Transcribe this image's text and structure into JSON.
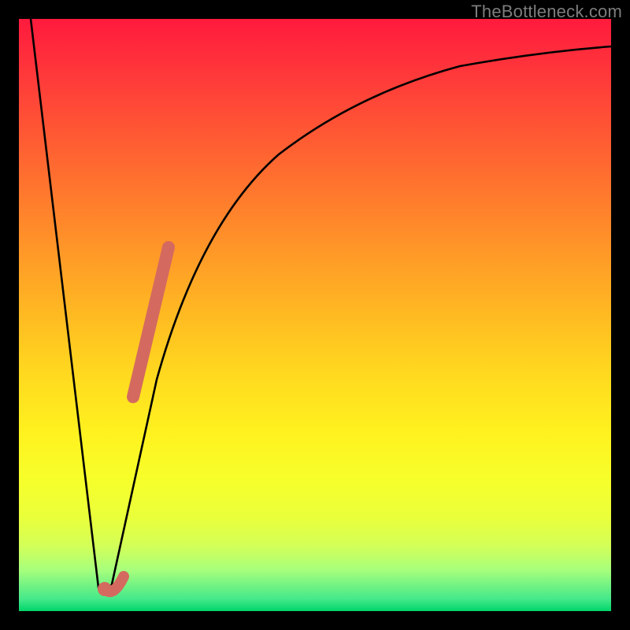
{
  "watermark": "TheBottleneck.com",
  "colors": {
    "frame": "#000000",
    "curve": "#000000",
    "highlight_stroke": "#d46a5f",
    "highlight_fill": "#d46a5f"
  },
  "chart_data": {
    "type": "line",
    "title": "",
    "xlabel": "",
    "ylabel": "",
    "xlim": [
      0,
      100
    ],
    "ylim": [
      0,
      100
    ],
    "grid": false,
    "legend": false,
    "series": [
      {
        "name": "bottleneck-curve",
        "x": [
          2,
          4,
          6,
          8,
          10,
          12,
          13.5,
          15,
          17,
          19,
          21,
          23,
          25,
          28,
          31,
          35,
          40,
          45,
          50,
          55,
          60,
          65,
          70,
          75,
          80,
          85,
          90,
          95,
          100
        ],
        "y": [
          100,
          86,
          72,
          58,
          44,
          24,
          4,
          7,
          22,
          36,
          48,
          57,
          62,
          67,
          72,
          76,
          80,
          83,
          85.5,
          87.5,
          89,
          90.3,
          91.4,
          92.3,
          93,
          93.6,
          94.1,
          94.5,
          94.8
        ]
      }
    ],
    "annotations": [
      {
        "name": "highlight-segment",
        "type": "line-overlay",
        "x": [
          19,
          20.5,
          22,
          23.5,
          25
        ],
        "y": [
          36,
          44,
          51,
          57,
          62
        ]
      },
      {
        "name": "optimal-marker",
        "type": "point",
        "x": 13.8,
        "y": 3.5
      }
    ]
  }
}
